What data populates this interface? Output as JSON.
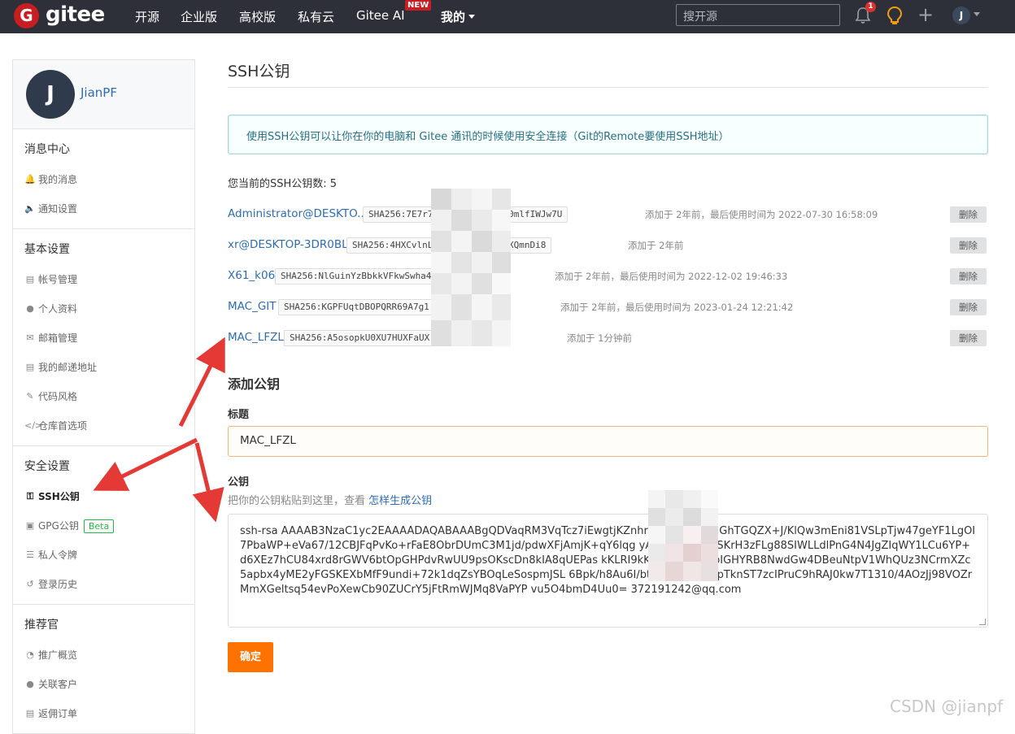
{
  "nav": {
    "logo_letter": "G",
    "logo_text": "gitee",
    "items": [
      "开源",
      "企业版",
      "高校版",
      "私有云",
      "Gitee AI",
      "我的"
    ],
    "new_badge": "NEW",
    "search_placeholder": "搜开源",
    "notification_count": "1",
    "user_initial": "J"
  },
  "sidebar": {
    "avatar_initial": "J",
    "username": "JianPF",
    "sections": [
      {
        "title": "消息中心",
        "items": [
          {
            "label": "我的消息",
            "icon": "bell-icon"
          },
          {
            "label": "通知设置",
            "icon": "speaker-icon"
          }
        ]
      },
      {
        "title": "基本设置",
        "items": [
          {
            "label": "帐号管理",
            "icon": "id-card-icon"
          },
          {
            "label": "个人资料",
            "icon": "user-icon"
          },
          {
            "label": "邮箱管理",
            "icon": "mail-icon"
          },
          {
            "label": "我的邮递地址",
            "icon": "address-card-icon"
          },
          {
            "label": "代码风格",
            "icon": "brush-icon"
          },
          {
            "label": "仓库首选项",
            "icon": "code-icon"
          }
        ]
      },
      {
        "title": "安全设置",
        "items": [
          {
            "label": "SSH公钥",
            "icon": "key-icon",
            "active": true
          },
          {
            "label": "GPG公钥",
            "icon": "lock-icon",
            "badge": "Beta"
          },
          {
            "label": "私人令牌",
            "icon": "sitemap-icon"
          },
          {
            "label": "登录历史",
            "icon": "history-icon"
          }
        ]
      },
      {
        "title": "推荐官",
        "items": [
          {
            "label": "推广概览",
            "icon": "pie-icon"
          },
          {
            "label": "关联客户",
            "icon": "users-icon"
          },
          {
            "label": "返佣订单",
            "icon": "order-icon"
          }
        ]
      }
    ]
  },
  "main": {
    "title": "SSH公钥",
    "info": "使用SSH公钥可以让你在你的电脑和 Gitee 通讯的时候使用安全连接（Git的Remote要使用SSH地址）",
    "count_label": "您当前的SSH公钥数: 5",
    "delete_label": "删除",
    "keys": [
      {
        "name": "Administrator@DESKTO...",
        "fingerprint": "SHA256:7E7r7                    go4Jjmuq1uDFa0mlfIWJw7U",
        "meta": "添加于 2年前，最后使用时间为 2022-07-30 16:58:09"
      },
      {
        "name": "xr@DESKTOP-3DR0BLI",
        "fingerprint": "SHA256:4HXCvlnL                 KDwsUzRpsasi9XQmnDi8",
        "meta": "添加于 2年前"
      },
      {
        "name": "X61_k06",
        "fingerprint": "SHA256:NlGuinYzBbkkVFkwSwha4                Pr+pa84",
        "meta": "添加于 2年前，最后使用时间为 2022-12-02 19:46:33"
      },
      {
        "name": "MAC_GIT",
        "fingerprint": "SHA256:KGPFUqtDBOPQRR69A7g1               H7ujVeGU",
        "meta": "添加于 2年前，最后使用时间为 2023-01-24 12:21:42"
      },
      {
        "name": "MAC_LFZL",
        "fingerprint": "SHA256:A5osopkU0XU7HUXFaUX               T9rH1n89k",
        "meta": "添加于 1分钟前"
      }
    ],
    "add_title": "添加公钥",
    "title_label": "标题",
    "title_value": "MAC_LFZL",
    "key_label": "公钥",
    "key_hint": "把你的公钥粘贴到这里，查看 ",
    "key_hint_link": "怎样生成公钥",
    "key_value": "ssh-rsa AAAAB3NzaC1yc2EAAAADAQABAAABgQDVaqRM3VqTcz7iEwgtjKZnhrAN6                KVIIVRtuGhTGQZX+J/KlQw3mEni81VSLpTjw47geYF1LgOI7PbaWP+eVa67/12CBJFqPvKo+rFaE8ObrDUmC3M1jd/pdwXFjAmjK+qY6lqg               yAbd1DpV5GZSKrH3zFLg88SIWLLdlPnG4N4JgZIqWY1LCu6YP+d6XEz7hCU84xrd8rGWV6btOpGHPdvRwUU9psOKscDn8kIA8qUEPas               kKLRI9kKTP9M0wEpypIGHYRB8NwdGw4DBeuNtpV1WhQUz3NCrmXZc5apbx4yME2yFGSKEXbMfF9undi+72k1dqZsYBOqLeSospmJSL               6Bpk/h8Au6I/btC62wAF4LOjpTknST7zcIPruC9hRAJ0kw7T1310/4AOzJj98VOZrMmXGeltsq54evPoXewCb90ZUCrY5jFtRmWJMq8VaPYP               vu5O4bmD4Uu0= 372191242@qq.com",
    "confirm_label": "确定"
  },
  "watermark": "CSDN @jianpf"
}
